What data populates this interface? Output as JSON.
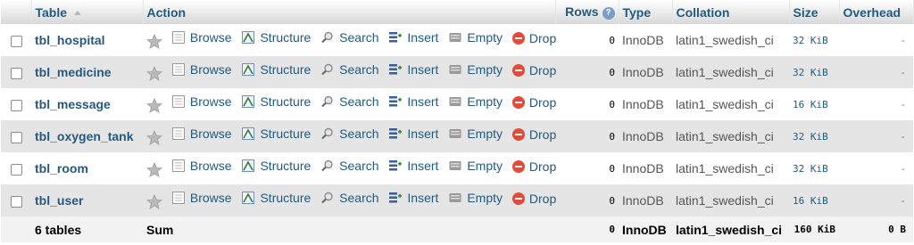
{
  "header": {
    "table": "Table",
    "action": "Action",
    "rows": "Rows",
    "type": "Type",
    "collation": "Collation",
    "size": "Size",
    "overhead": "Overhead"
  },
  "actions": {
    "browse": "Browse",
    "structure": "Structure",
    "search": "Search",
    "insert": "Insert",
    "empty": "Empty",
    "drop": "Drop"
  },
  "rows": [
    {
      "name": "tbl_hospital",
      "rows": "0",
      "type": "InnoDB",
      "collation": "latin1_swedish_ci",
      "size": "32 KiB",
      "overhead": "-"
    },
    {
      "name": "tbl_medicine",
      "rows": "0",
      "type": "InnoDB",
      "collation": "latin1_swedish_ci",
      "size": "32 KiB",
      "overhead": "-"
    },
    {
      "name": "tbl_message",
      "rows": "0",
      "type": "InnoDB",
      "collation": "latin1_swedish_ci",
      "size": "16 KiB",
      "overhead": "-"
    },
    {
      "name": "tbl_oxygen_tank",
      "rows": "0",
      "type": "InnoDB",
      "collation": "latin1_swedish_ci",
      "size": "32 KiB",
      "overhead": "-"
    },
    {
      "name": "tbl_room",
      "rows": "0",
      "type": "InnoDB",
      "collation": "latin1_swedish_ci",
      "size": "32 KiB",
      "overhead": "-"
    },
    {
      "name": "tbl_user",
      "rows": "0",
      "type": "InnoDB",
      "collation": "latin1_swedish_ci",
      "size": "16 KiB",
      "overhead": "-"
    }
  ],
  "footer": {
    "count": "6 tables",
    "sum": "Sum",
    "rows": "0",
    "type": "InnoDB",
    "collation": "latin1_swedish_ci",
    "size": "160 KiB",
    "overhead": "0 B"
  },
  "colors": {
    "link": "#235a81",
    "row_alt": "#e5e5e5",
    "drop": "#e24b3b"
  }
}
